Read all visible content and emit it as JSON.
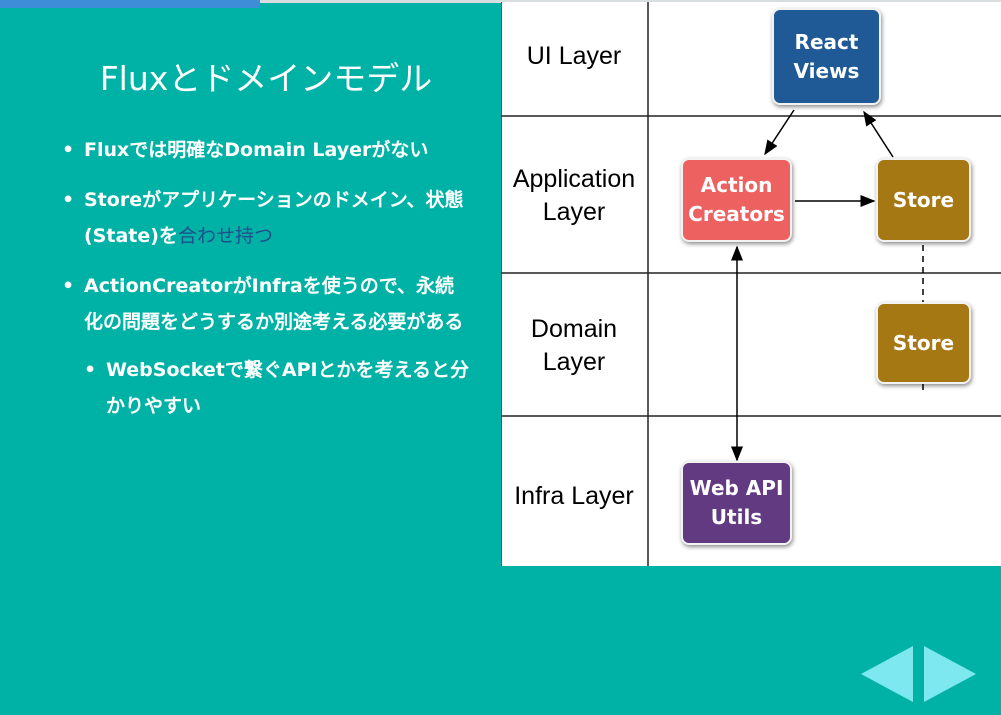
{
  "progress": {
    "fraction": 0.26
  },
  "slide": {
    "title": "Fluxとドメインモデル",
    "bullets": [
      "Fluxでは明確なDomain Layerがない",
      "Storeがアプリケーションのドメイン、状態(State)を",
      "ActionCreatorがInfraを使うので、永続化の問題をどうするか別途考える必要がある"
    ],
    "bullet2_link": "合わせ持つ",
    "sub_bullet": "WebSocketで繋ぐAPIとかを考えると分かりやすい"
  },
  "diagram": {
    "layers": [
      "UI Layer",
      "Application Layer",
      "Domain Layer",
      "Infra Layer"
    ],
    "boxes": {
      "react_views": "React Views",
      "action_creators": "Action Creators",
      "store_app": "Store",
      "store_domain": "Store",
      "web_api_utils": "Web API Utils"
    },
    "colors": {
      "react_views": "#1f5a96",
      "action_creators": "#ee6161",
      "store": "#a67813",
      "web_api_utils": "#623a82"
    }
  },
  "nav": {
    "prev_icon": "triangle-left-icon",
    "next_icon": "triangle-right-icon",
    "color": "#7de8ef"
  }
}
